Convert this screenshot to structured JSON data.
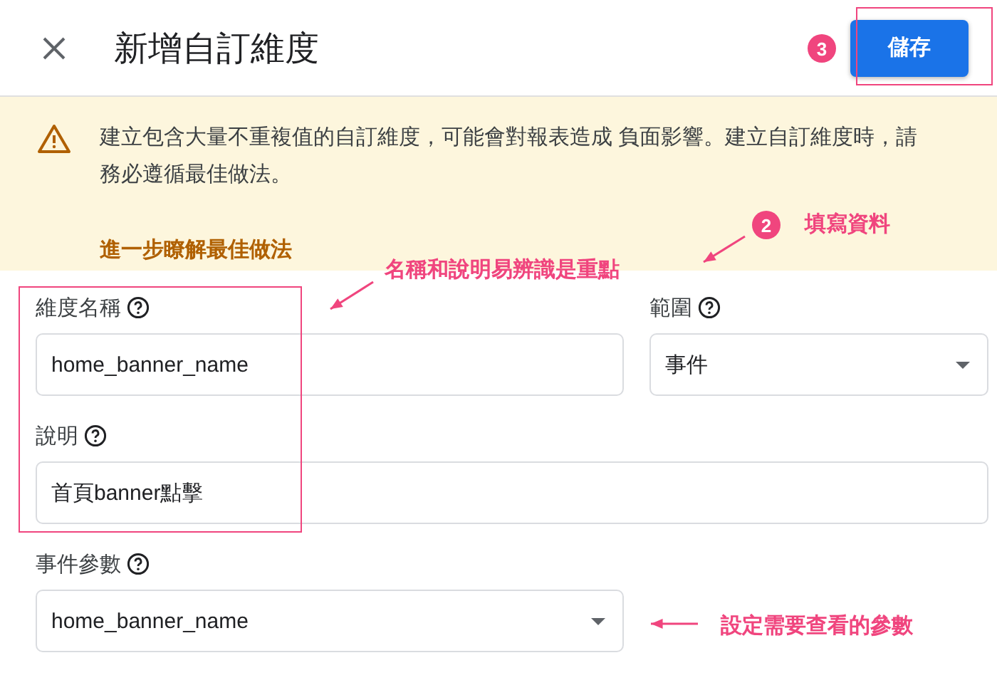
{
  "header": {
    "title": "新增自訂維度",
    "save_button": "儲存"
  },
  "banner": {
    "message": "建立包含大量不重複值的自訂維度，可能會對報表造成 負面影響。建立自訂維度時，請務必遵循最佳做法。",
    "link": "進一步瞭解最佳做法"
  },
  "fields": [
    {
      "kind": "text",
      "label": "維度名稱",
      "value": "home_banner_name"
    },
    {
      "kind": "select",
      "label": "範圍",
      "value": "事件"
    },
    {
      "kind": "text",
      "label": "說明",
      "value": "首頁banner點擊"
    },
    {
      "kind": "select",
      "label": "事件參數",
      "value": "home_banner_name"
    }
  ],
  "annotations": [
    {
      "kind": "badge",
      "text": "3"
    },
    {
      "kind": "frame"
    },
    {
      "kind": "badge",
      "text": "2"
    },
    {
      "kind": "note",
      "text": "填寫資料"
    },
    {
      "kind": "arrow"
    },
    {
      "kind": "note",
      "text": "名稱和說明易辨識是重點"
    },
    {
      "kind": "arrow"
    },
    {
      "kind": "frame"
    },
    {
      "kind": "arrow"
    },
    {
      "kind": "note",
      "text": "設定需要查看的參數"
    }
  ]
}
